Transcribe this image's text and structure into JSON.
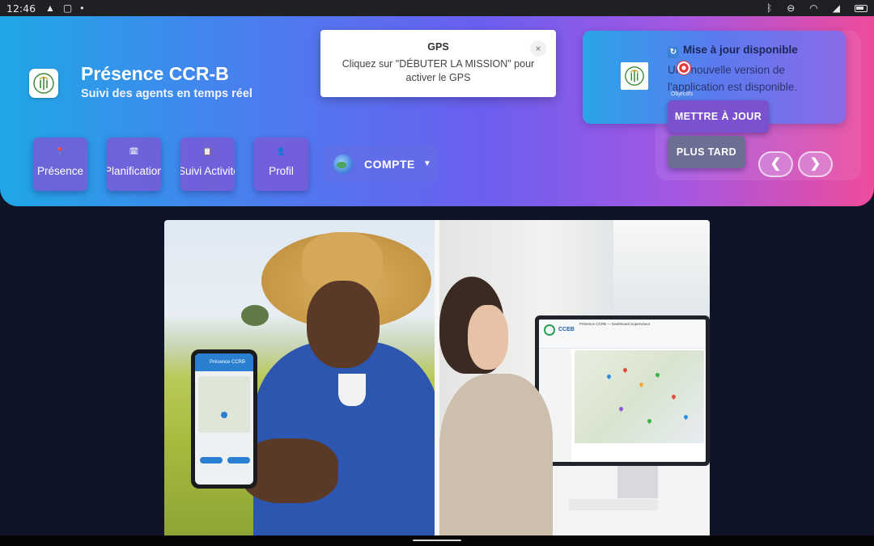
{
  "status_bar": {
    "time": "12:46",
    "left_icons": [
      "alert-icon",
      "screen-icon",
      "dot-icon"
    ],
    "right_icons": [
      "bluetooth-icon",
      "dnd-icon",
      "wifi-icon",
      "signal-icon",
      "battery-icon"
    ]
  },
  "app": {
    "title": "Présence CCR-B",
    "subtitle": "Suivi des agents en temps réel"
  },
  "nav": [
    {
      "label": "Présence",
      "icon": "pin-icon"
    },
    {
      "label": "Planification",
      "icon": "calendar-icon"
    },
    {
      "label": "Suivi Activités",
      "icon": "clipboard-icon"
    },
    {
      "label": "Profil",
      "icon": "user-icon"
    }
  ],
  "account": {
    "label": "COMPTE",
    "icon": "globe-icon"
  },
  "gps_toast": {
    "title": "GPS",
    "message": "Cliquez sur \"DÉBUTER LA MISSION\" pour activer le GPS",
    "close": "×"
  },
  "update_panel": {
    "title": "Mise à jour disponible",
    "message": "Une nouvelle version de l'application est disponible.",
    "objectives_label": "Objectifs",
    "update_button": "METTRE À JOUR",
    "later_button": "PLUS TARD",
    "prev": "❮",
    "next": "❯"
  },
  "hero": {
    "phone_header": "Présence CCRB",
    "monitor_logo": "CCEB",
    "monitor_title": "Présence CCRB — Dashboard Superviseur"
  },
  "colors": {
    "header_start": "#1fa7e6",
    "header_mid": "#6b5ff0",
    "header_end": "#ee4b9b",
    "page_bg": "#0f1527",
    "nav_button": "#7a5ad7"
  }
}
